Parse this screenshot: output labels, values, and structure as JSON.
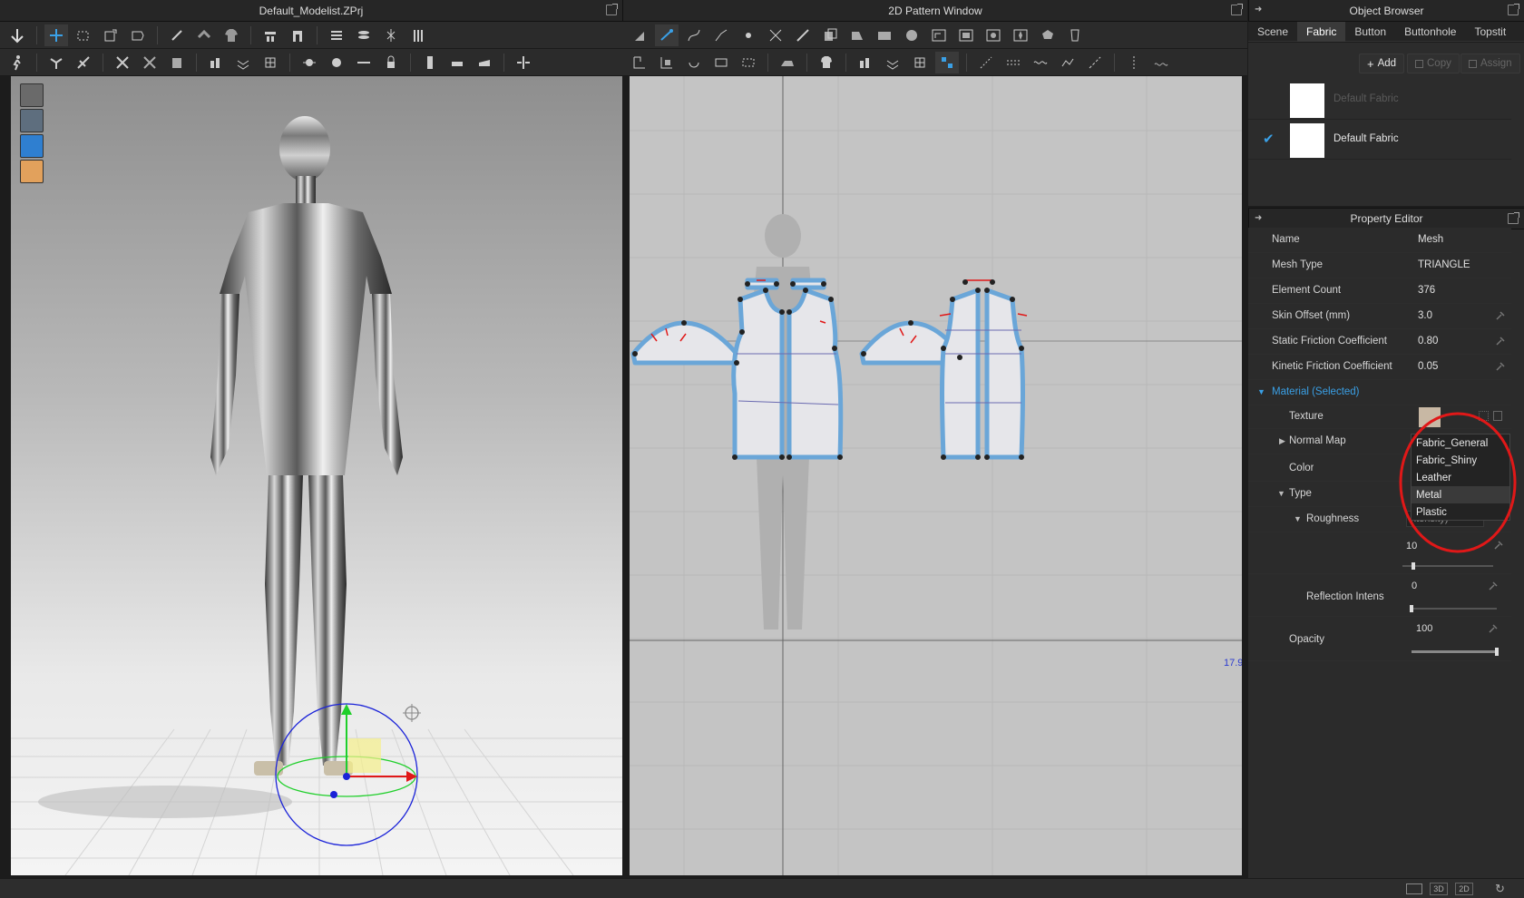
{
  "left_panel": {
    "title": "Default_Modelist.ZPrj"
  },
  "center_panel": {
    "title": "2D Pattern Window",
    "coord_readout": "17.9"
  },
  "object_browser": {
    "title": "Object Browser",
    "tabs": [
      "Scene",
      "Fabric",
      "Button",
      "Buttonhole",
      "Topstit"
    ],
    "active_tab": "Fabric",
    "buttons": {
      "add": "Add",
      "copy": "Copy",
      "assign": "Assign"
    },
    "fabrics": [
      {
        "name": "Default Fabric",
        "checked": false,
        "dimmed": true
      },
      {
        "name": "Default Fabric",
        "checked": true,
        "dimmed": false
      }
    ]
  },
  "property_editor": {
    "title": "Property Editor",
    "rows": [
      {
        "label": "Name",
        "value": "Mesh",
        "pin": false
      },
      {
        "label": "Mesh Type",
        "value": "TRIANGLE",
        "pin": false
      },
      {
        "label": "Element Count",
        "value": "376",
        "pin": false
      },
      {
        "label": "Skin Offset (mm)",
        "value": "3.0",
        "pin": true
      },
      {
        "label": "Static Friction Coefficient",
        "value": "0.80",
        "pin": true
      },
      {
        "label": "Kinetic Friction Coefficient",
        "value": "0.05",
        "pin": true
      }
    ],
    "material_section": "Material (Selected)",
    "texture_label": "Texture",
    "normal_map_label": "Normal Map",
    "color_label": "Color",
    "type_label": "Type",
    "roughness_label": "Roughness",
    "roughness_partial": "ntensity)",
    "roughness_value": "10",
    "reflection_label": "Reflection Intens",
    "reflection_value": "0",
    "opacity_label": "Opacity",
    "opacity_value": "100",
    "roughness_slider": 0.1,
    "reflection_slider": 0.0,
    "opacity_slider": 1.0
  },
  "type_dropdown": {
    "options": [
      "Fabric_General",
      "Fabric_Shiny",
      "Leather",
      "Metal",
      "Plastic"
    ],
    "highlighted": "Metal"
  },
  "status_bar": {
    "btn_3d": "3D",
    "btn_2d": "2D"
  },
  "colors": {
    "accent": "#3aa0e6",
    "annotation": "#e01818",
    "pattern_outline": "#6aa6d8"
  }
}
